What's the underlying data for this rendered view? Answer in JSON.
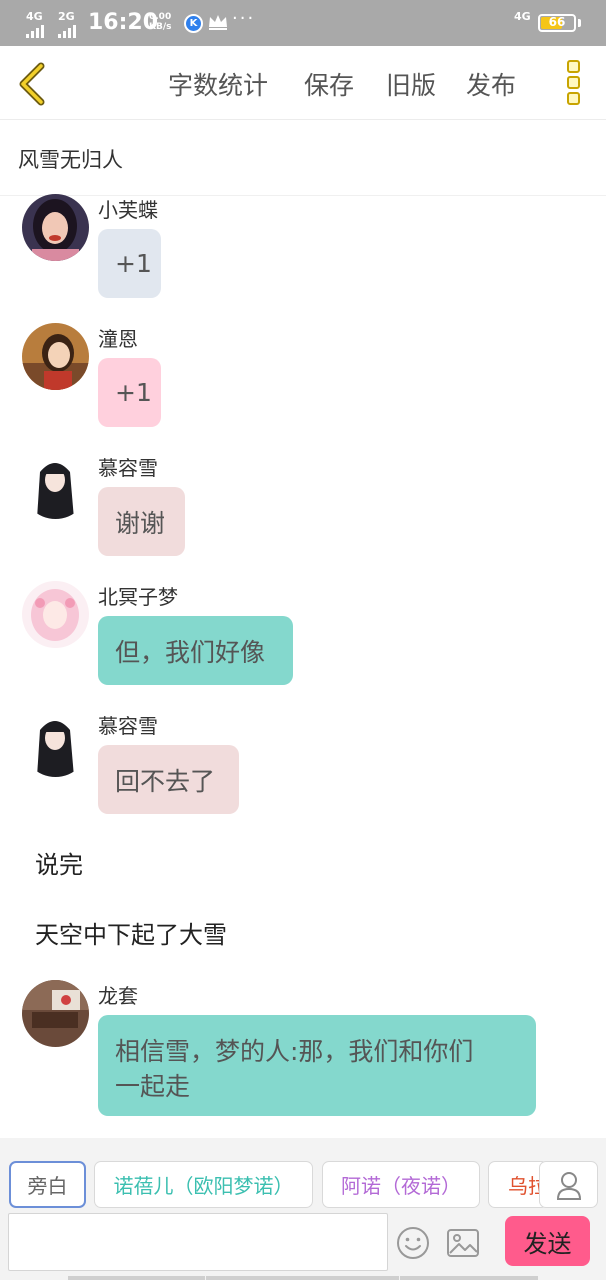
{
  "status_bar": {
    "net1": "4G",
    "net2": "2G",
    "time": "16:20",
    "speed_value": "0.00",
    "speed_unit": "KB/s",
    "k_badge": "K",
    "more": "···",
    "net_right": "4G",
    "battery": "66",
    "battery_level": 0.66,
    "battery_color": "#f5c518"
  },
  "toolbar": {
    "back_icon": "chevron-left-icon",
    "word_count": "字数统计",
    "save": "保存",
    "old_version": "旧版",
    "publish": "发布",
    "more_icon": "vertical-squares-menu-icon"
  },
  "story_title": "风雪无归人",
  "messages": [
    {
      "type": "dialog",
      "speaker": "小芙蝶",
      "text": "+1",
      "bubble_color": "#e1e7ef"
    },
    {
      "type": "dialog",
      "speaker": "潼恩",
      "text": "+1",
      "bubble_color": "#ffd0dd"
    },
    {
      "type": "dialog",
      "speaker": "慕容雪",
      "text": "谢谢",
      "bubble_color": "#f1dcdc"
    },
    {
      "type": "dialog",
      "speaker": "北冥子梦",
      "text": "但，我们好像",
      "bubble_color": "#84d8cd"
    },
    {
      "type": "dialog",
      "speaker": "慕容雪",
      "text": "回不去了",
      "bubble_color": "#f1dcdc"
    },
    {
      "type": "narration",
      "text": "说完"
    },
    {
      "type": "narration",
      "text": "天空中下起了大雪"
    },
    {
      "type": "dialog",
      "speaker": "龙套",
      "text_line1": "相信雪，梦的人:那，我们和你们",
      "text_line2": "一起走",
      "bubble_color": "#84d8cd"
    }
  ],
  "roles": [
    {
      "label": "旁白",
      "color": "#666666"
    },
    {
      "label": "诺蓓儿（欧阳梦诺）",
      "color": "#3bbfb0"
    },
    {
      "label": "阿诺（夜诺）",
      "color": "#b36ad6"
    },
    {
      "label": "乌拉",
      "color": "#e0512e"
    }
  ],
  "input": {
    "value": "",
    "placeholder": ""
  },
  "send_button": "发送",
  "icons": {
    "person": "person-icon",
    "emoji": "smiley-icon",
    "image": "image-icon"
  }
}
